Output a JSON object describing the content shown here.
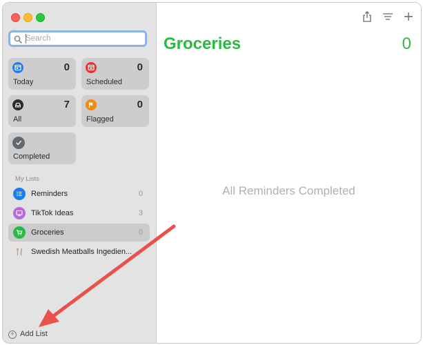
{
  "search": {
    "placeholder": "Search"
  },
  "smart_lists": [
    {
      "label": "Today",
      "count": "0",
      "color": "#1a7ef0",
      "icon": "calendar-icon"
    },
    {
      "label": "Scheduled",
      "count": "0",
      "color": "#e8302c",
      "icon": "calendar-clock-icon"
    },
    {
      "label": "All",
      "count": "7",
      "color": "#2b2b2b",
      "icon": "tray-icon"
    },
    {
      "label": "Flagged",
      "count": "0",
      "color": "#f08a10",
      "icon": "flag-icon"
    },
    {
      "label": "Completed",
      "count": "",
      "color": "#626a70",
      "icon": "checkmark-icon"
    }
  ],
  "my_lists": {
    "title": "My Lists",
    "items": [
      {
        "label": "Reminders",
        "count": "0",
        "color": "#1a7ef0",
        "icon": "bullet-list-icon"
      },
      {
        "label": "TikTok Ideas",
        "count": "3",
        "color": "#b56cd8",
        "icon": "monitor-icon"
      },
      {
        "label": "Groceries",
        "count": "0",
        "color": "#2bb845",
        "icon": "cart-icon",
        "selected": true
      },
      {
        "label": "Swedish Meatballs Ingedien...",
        "count": "",
        "color": "#ffffff",
        "icon": "fork-knife-icon"
      }
    ]
  },
  "add_list": {
    "label": "Add List"
  },
  "main": {
    "title": "Groceries",
    "count": "0",
    "empty_message": "All Reminders Completed",
    "accent": "#2bb845"
  },
  "toolbar": {
    "icons": [
      "share-icon",
      "view-options-icon",
      "add-icon"
    ]
  }
}
